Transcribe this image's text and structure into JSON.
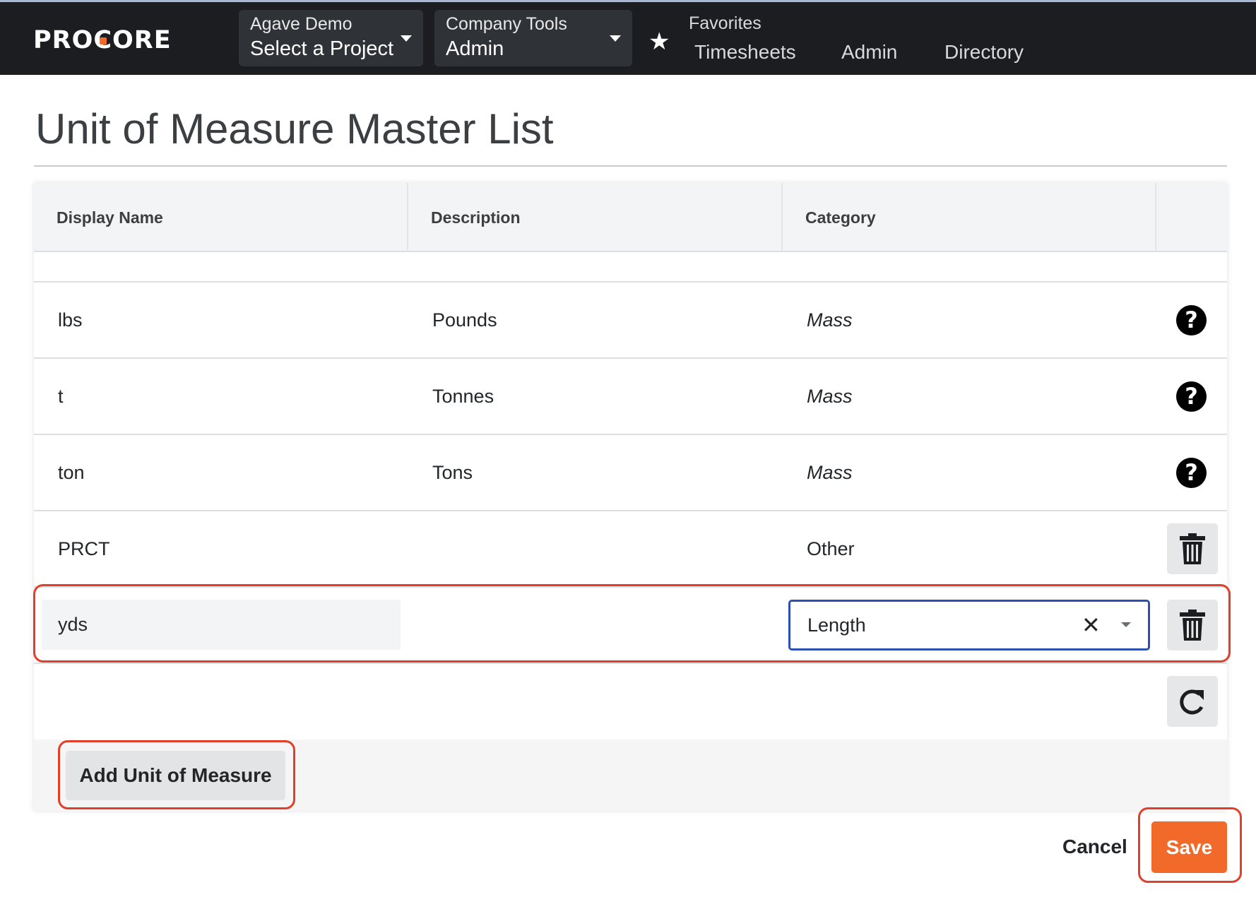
{
  "nav": {
    "logo": "PROCORE",
    "project_dropdown": {
      "label": "Agave Demo",
      "value": "Select a Project"
    },
    "tool_dropdown": {
      "label": "Company Tools",
      "value": "Admin"
    },
    "favorites": {
      "label": "Favorites",
      "links": [
        "Timesheets",
        "Admin",
        "Directory"
      ]
    }
  },
  "page": {
    "title": "Unit of Measure Master List"
  },
  "table": {
    "headers": [
      "Display Name",
      "Description",
      "Category"
    ],
    "rows": [
      {
        "name": "lbs",
        "description": "Pounds",
        "category": "Mass",
        "action": "help-icon"
      },
      {
        "name": "t",
        "description": "Tonnes",
        "category": "Mass",
        "action": "help-icon"
      },
      {
        "name": "ton",
        "description": "Tons",
        "category": "Mass",
        "action": "help-icon"
      },
      {
        "name": "PRCT",
        "description": "",
        "category": "Other",
        "action": "trash-icon"
      }
    ],
    "edit_row": {
      "name_value": "yds",
      "category_value": "Length"
    },
    "add_button": "Add Unit of Measure"
  },
  "actions": {
    "cancel": "Cancel",
    "save": "Save"
  },
  "colors": {
    "accent": "#f26a2a",
    "highlight": "#e0402a",
    "focus": "#2d4fb0"
  }
}
